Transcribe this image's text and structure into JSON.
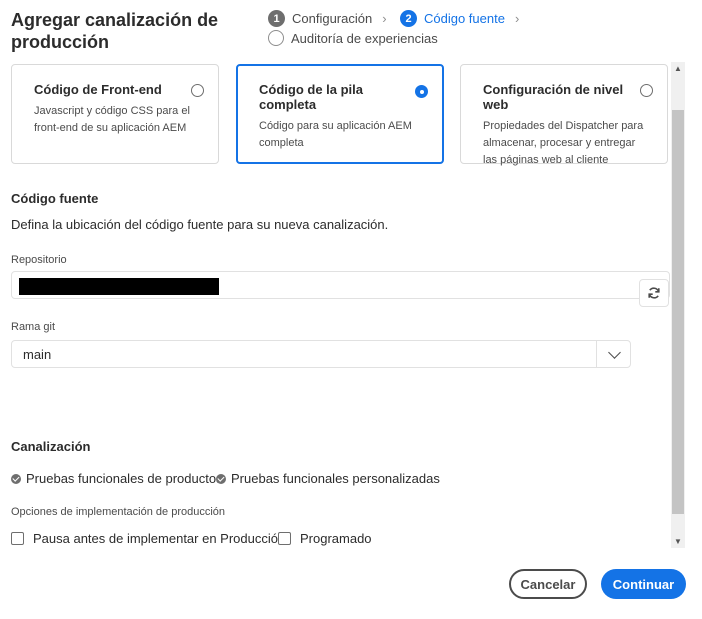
{
  "dialog": {
    "title": "Agregar canalización de producción"
  },
  "stepper": {
    "steps": [
      {
        "number": "1",
        "label": "Configuración"
      },
      {
        "number": "2",
        "label": "Código fuente"
      },
      {
        "number": "",
        "label": "Auditoría de experiencias"
      }
    ]
  },
  "cards": [
    {
      "title": "Código de Front-end",
      "description": "Javascript y código CSS para el front-end de su aplicación AEM"
    },
    {
      "title": "Código de la pila completa",
      "description": "Código para su aplicación AEM completa"
    },
    {
      "title": "Configuración de nivel web",
      "description": "Propiedades del Dispatcher para almacenar, procesar y entregar las páginas web al cliente"
    }
  ],
  "source": {
    "heading": "Código fuente",
    "description": "Defina la ubicación del código fuente para su nueva canalización.",
    "repository_label": "Repositorio",
    "branch_label": "Rama git",
    "branch_value": "main"
  },
  "pipeline": {
    "heading": "Canalización",
    "checks": [
      "Pruebas funcionales de productos",
      "Pruebas funcionales personalizadas"
    ],
    "deploy_options_label": "Opciones de implementación de producción",
    "options": [
      "Pausa antes de implementar en Producción",
      "Programado"
    ]
  },
  "footer": {
    "cancel_label": "Cancelar",
    "continue_label": "Continuar"
  },
  "colors": {
    "accent": "#1473e6",
    "text": "#2c2c2c",
    "border": "#e1e1e1"
  }
}
